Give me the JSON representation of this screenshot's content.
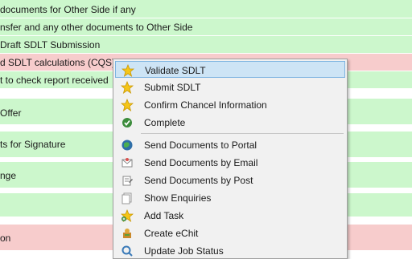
{
  "rows": [
    {
      "text": "documents for Other Side if any",
      "status": "green"
    },
    {
      "text": "nsfer and any other documents to Other Side",
      "status": "green"
    },
    {
      "text": "Draft SDLT Submission",
      "status": "green"
    },
    {
      "text": "d SDLT calculations (CQS)",
      "status": "red"
    },
    {
      "text": "t to check report received",
      "status": "green"
    },
    {
      "text": "Offer",
      "status": "green"
    },
    {
      "text": "ts for Signature",
      "status": "green"
    },
    {
      "text": "nge",
      "status": "green"
    },
    {
      "text": "",
      "status": "green"
    },
    {
      "text": "on",
      "status": "red"
    }
  ],
  "context_menu": {
    "items": [
      {
        "label": "Validate SDLT",
        "icon": "star-icon",
        "selected": true
      },
      {
        "label": "Submit SDLT",
        "icon": "star-icon"
      },
      {
        "label": "Confirm Chancel Information",
        "icon": "star-icon"
      },
      {
        "label": "Complete",
        "icon": "check-circle-icon"
      },
      {
        "label": "Send Documents to Portal",
        "icon": "globe-icon"
      },
      {
        "label": "Send Documents by Email",
        "icon": "email-icon"
      },
      {
        "label": "Send Documents by Post",
        "icon": "post-icon"
      },
      {
        "label": "Show Enquiries",
        "icon": "enquiries-icon"
      },
      {
        "label": "Add Task",
        "icon": "add-task-icon"
      },
      {
        "label": "Create eChit",
        "icon": "echit-icon"
      },
      {
        "label": "Update Job Status",
        "icon": "job-status-icon"
      }
    ]
  },
  "colors": {
    "green_row": "#ccf7cc",
    "red_row": "#f7cccc",
    "menu_bg": "#f1f1f1",
    "selected_bg": "#cde4f5"
  }
}
